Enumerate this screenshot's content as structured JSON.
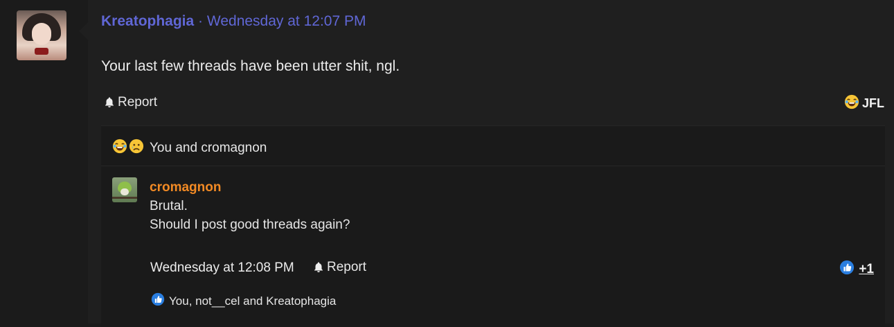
{
  "post": {
    "author": "Kreatophagia",
    "separator": "·",
    "timestamp": "Wednesday at 12:07 PM",
    "body": "Your last few threads have been utter shit, ngl.",
    "report_label": "Report",
    "reaction_label": "JFL",
    "reaction_icon": "laughing-crying-emoji"
  },
  "reactions_summary": {
    "icons": [
      "laughing-crying-emoji",
      "sad-emoji"
    ],
    "text": "You and cromagnon"
  },
  "reply": {
    "author": "cromagnon",
    "lines": [
      "Brutal.",
      "Should I post good threads again?"
    ],
    "timestamp": "Wednesday at 12:08 PM",
    "report_label": "Report",
    "like_count": "+1",
    "likes_text": "You, not__cel and Kreatophagia"
  },
  "colors": {
    "author_link": "#6067d6",
    "reply_author": "#f28a24",
    "like_blue": "#2a7ee0"
  }
}
